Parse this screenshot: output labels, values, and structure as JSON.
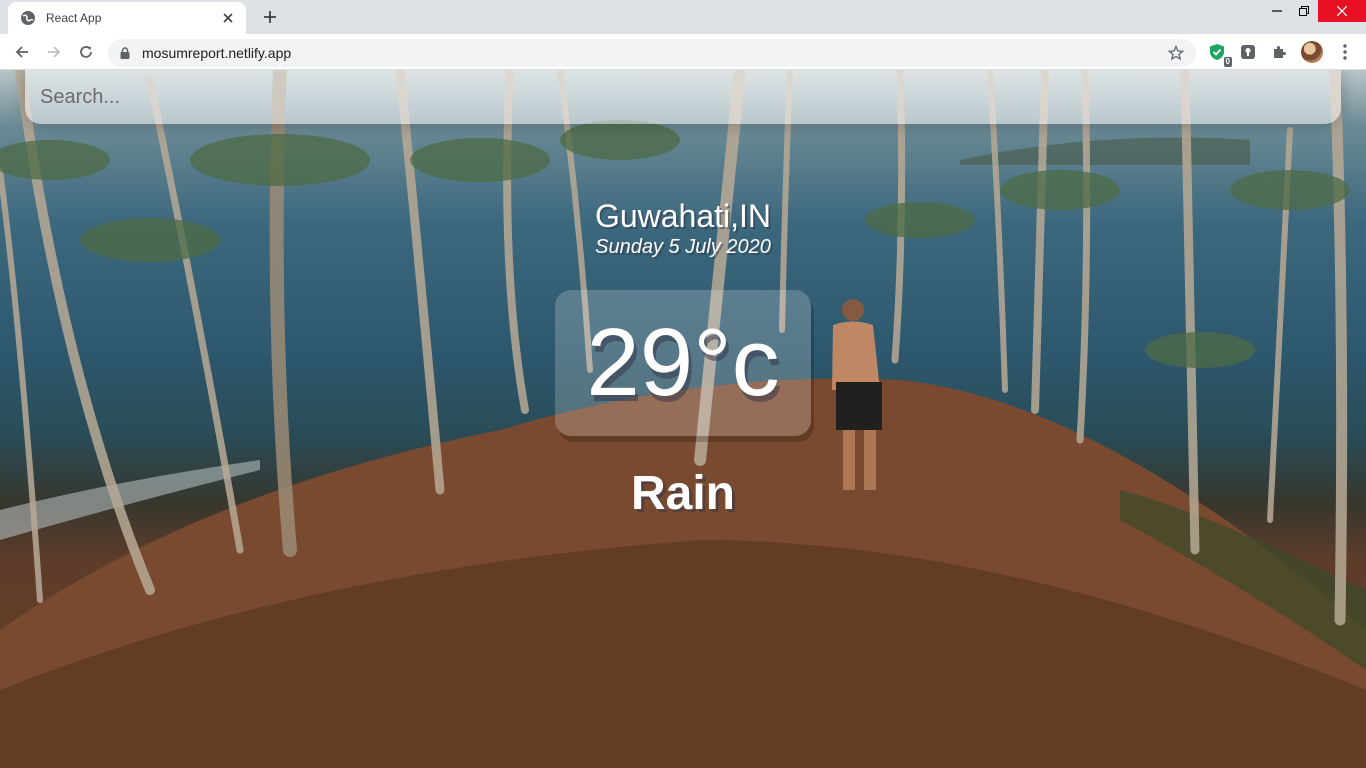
{
  "browser": {
    "tab_title": "React App",
    "url": "mosumreport.netlify.app",
    "extension_badge": "0"
  },
  "search": {
    "placeholder": "Search...",
    "value": ""
  },
  "weather": {
    "location": "Guwahati,IN",
    "date": "Sunday 5 July 2020",
    "temperature": "29°c",
    "condition": "Rain"
  },
  "colors": {
    "close_button": "#e81123",
    "text": "#ffffff"
  }
}
